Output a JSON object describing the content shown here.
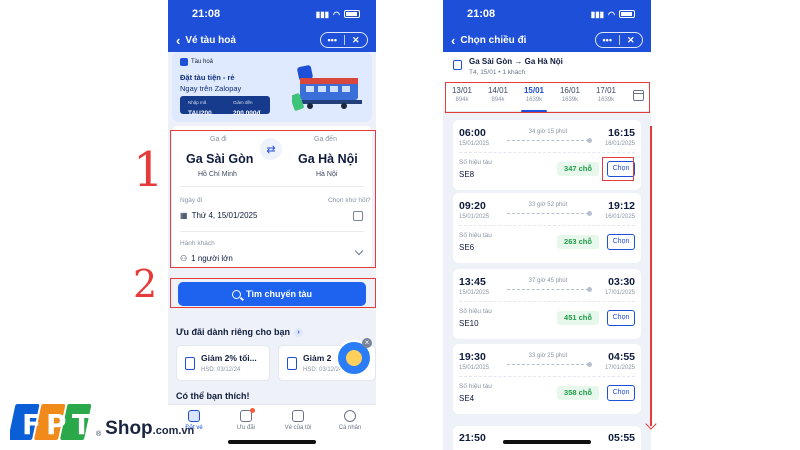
{
  "left_phone": {
    "status_time": "21:08",
    "nav_title": "Vé tàu hoả",
    "nav_more": "•••",
    "nav_close": "✕",
    "banner": {
      "tag": "Tàu hoả",
      "headline": "Đặt tàu tiện - rẻ",
      "subline": "Ngay trên Zalopay",
      "code_label": "Nhập mã",
      "code": "TAU200",
      "discount_label": "Giảm đến",
      "discount": "200.000đ"
    },
    "search": {
      "from_label": "Ga đi",
      "from_station": "Ga Sài Gòn",
      "from_city": "Hồ Chí Minh",
      "to_label": "Ga đến",
      "to_station": "Ga Hà Nội",
      "to_city": "Hà Nội",
      "date_label": "Ngày đi",
      "date_value": "Thứ 4, 15/01/2025",
      "return_label": "Chọn khứ hồi?",
      "passenger_label": "Hành khách",
      "passenger_value": "1 người lớn",
      "button_label": "Tìm chuyến tàu"
    },
    "offers": {
      "title": "Ưu đãi dành riêng cho bạn",
      "items": [
        {
          "title": "Giảm 2% tối...",
          "expiry": "HSD: 03/12/24"
        },
        {
          "title": "Giảm 2",
          "expiry": "HSD: 03/12/24"
        }
      ]
    },
    "maybe_title": "Có thể bạn thích!",
    "tabs": [
      {
        "label": "Đặt vé"
      },
      {
        "label": "Ưu đãi"
      },
      {
        "label": "Vé của tôi"
      },
      {
        "label": "Cá nhân"
      }
    ]
  },
  "right_phone": {
    "status_time": "21:08",
    "nav_title": "Chọn chiều đi",
    "nav_more": "•••",
    "nav_close": "✕",
    "route": {
      "from": "Ga Sài Gòn",
      "arrow": "→",
      "to": "Ga Hà Nội",
      "summary": "T4, 15/01 • 1 khách"
    },
    "dates": [
      {
        "date": "13/01",
        "price": "894k"
      },
      {
        "date": "14/01",
        "price": "894k"
      },
      {
        "date": "15/01",
        "price": "1639k",
        "selected": true
      },
      {
        "date": "16/01",
        "price": "1639k"
      },
      {
        "date": "17/01",
        "price": "1639k"
      }
    ],
    "trains": [
      {
        "dep_time": "06:00",
        "dep_date": "15/01/2025",
        "duration": "34 giờ 15 phút",
        "arr_time": "16:15",
        "arr_date": "16/01/2025",
        "train_label": "Số hiệu tàu",
        "train_no": "SE8",
        "seats": "347 chỗ",
        "choose": "Chọn"
      },
      {
        "dep_time": "09:20",
        "dep_date": "15/01/2025",
        "duration": "33 giờ 52 phút",
        "arr_time": "19:12",
        "arr_date": "16/01/2025",
        "train_label": "Số hiệu tàu",
        "train_no": "SE6",
        "seats": "263 chỗ",
        "choose": "Chọn"
      },
      {
        "dep_time": "13:45",
        "dep_date": "15/01/2025",
        "duration": "37 giờ 45 phút",
        "arr_time": "03:30",
        "arr_date": "17/01/2025",
        "train_label": "Số hiệu tàu",
        "train_no": "SE10",
        "seats": "451 chỗ",
        "choose": "Chọn"
      },
      {
        "dep_time": "19:30",
        "dep_date": "15/01/2025",
        "duration": "33 giờ 25 phút",
        "arr_time": "04:55",
        "arr_date": "17/01/2025",
        "train_label": "Số hiệu tàu",
        "train_no": "SE4",
        "seats": "358 chỗ",
        "choose": "Chọn"
      }
    ],
    "partial_train": {
      "dep_time": "21:50",
      "arr_time": "05:55"
    }
  },
  "annotations": {
    "step1": "1",
    "step2": "2"
  },
  "logo": {
    "brand_letters": "FPT",
    "shop": "Shop",
    "domain": ".com.vn",
    "registered": "®",
    "colors": {
      "f": "#0a5fd6",
      "p": "#f08a1b",
      "t": "#2aa84a"
    }
  },
  "colors": {
    "accent": "#1e4fd9",
    "button": "#1e63ef",
    "annotation_red": "#e53b3b",
    "seats_green": "#1f9d48"
  }
}
